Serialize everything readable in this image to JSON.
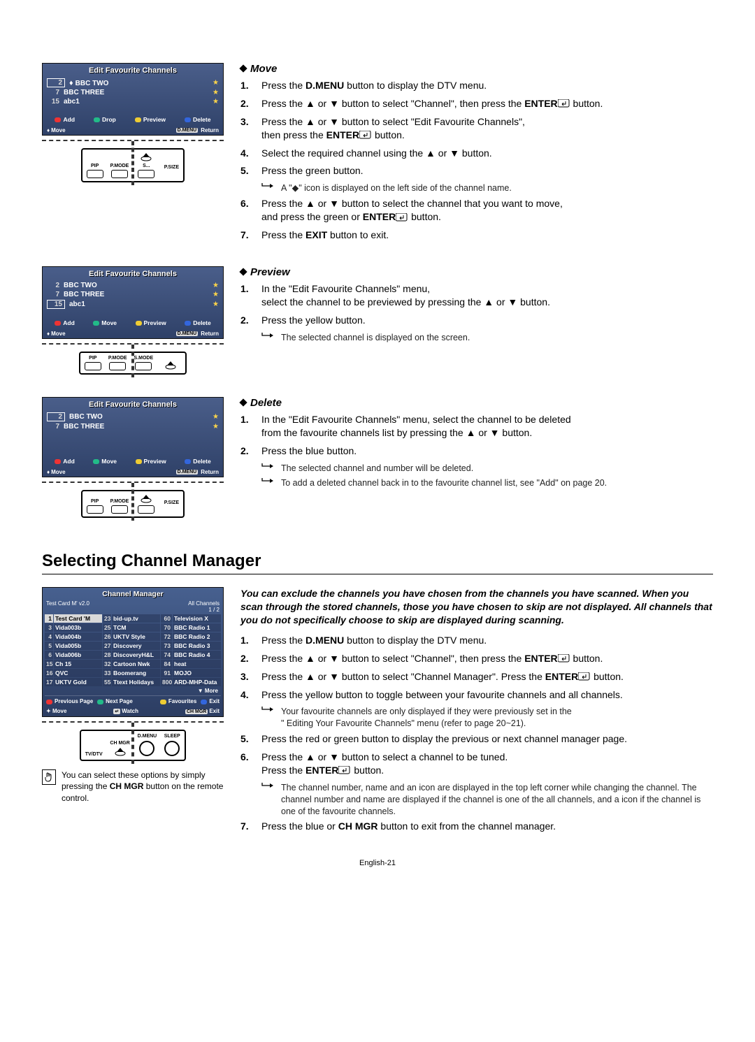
{
  "osdTitle": "Edit Favourite Channels",
  "channels": {
    "bbcTwo": {
      "num": "2",
      "name": "BBC TWO"
    },
    "bbcThree": {
      "num": "7",
      "name": "BBC THREE"
    },
    "abc1": {
      "num": "15",
      "name": "abc1"
    }
  },
  "legend": {
    "add": "Add",
    "drop": "Drop",
    "move": "Move",
    "preview": "Preview",
    "delete": "Delete"
  },
  "osdFooter": {
    "move": "Move",
    "dmenu": "D.MENU",
    "ret": "Return"
  },
  "remote": {
    "pip": "PIP",
    "pmode": "P.MODE",
    "smode": "S.MODE",
    "sx": "S...",
    "psize": "P.SIZE",
    "ttv": "TV/DTV",
    "chmgr": "CH MGR",
    "dmenu": "D.MENU",
    "sleep": "SLEEP"
  },
  "move": {
    "title": "Move",
    "steps": [
      "Press the <b>D.MENU</b> button to display the DTV menu.",
      "Press the ▲ or ▼ button to select \"Channel\", then press the <b>ENTER</b><svg class='enter-icon' width='18' height='12'><rect x='0' y='0' width='16' height='11' rx='2' fill='none' stroke='#000'/><path d='M11 3 v4 h-5 m0 0 l2 -2 m-2 2 l2 2' stroke='#000' fill='none'/></svg> button.",
      "Press the ▲ or ▼ button to select \"Edit Favourite Channels\",<br>then press the <b>ENTER</b><svg class='enter-icon' width='18' height='12'><rect x='0' y='0' width='16' height='11' rx='2' fill='none' stroke='#000'/><path d='M11 3 v4 h-5 m0 0 l2 -2 m-2 2 l2 2' stroke='#000' fill='none'/></svg> button.",
      "Select the required channel using the ▲ or ▼ button.",
      "Press the green button.",
      "Press the ▲ or ▼ button to select the channel that you want to move,<br>and press the green or <b>ENTER</b><svg class='enter-icon' width='18' height='12'><rect x='0' y='0' width='16' height='11' rx='2' fill='none' stroke='#000'/><path d='M11 3 v4 h-5 m0 0 l2 -2 m-2 2 l2 2' stroke='#000' fill='none'/></svg> button.",
      "Press the <b>EXIT</b> button to exit."
    ],
    "note5": "A \"<span class='inline-icon'>◆</span>\" icon is displayed on the left side of the channel name."
  },
  "preview": {
    "title": "Preview",
    "steps": [
      "In the \"Edit Favourite Channels\" menu,<br>select the channel to be previewed by pressing the ▲ or ▼ button.",
      "Press the yellow button."
    ],
    "note2": "The selected channel is displayed on the screen."
  },
  "delete": {
    "title": "Delete",
    "steps": [
      "In the \"Edit Favourite Channels\" menu, select the channel to be deleted<br>from the favourite channels list by pressing the ▲ or ▼ button.",
      "Press the blue button."
    ],
    "notes": [
      "The selected channel and number will be deleted.",
      "To add a deleted channel back in to the favourite channel list, see \"Add\" on page 20."
    ]
  },
  "selectCM": {
    "title": "Selecting Channel Manager",
    "intro": "You can exclude the channels you have chosen from the channels you have scanned. When you scan through the stored channels, those you have chosen to skip are not displayed. All channels that you do not specifically choose to skip are displayed during scanning.",
    "steps": [
      "Press the <b>D.MENU</b> button to display the DTV menu.",
      "Press the ▲ or ▼ button to select \"Channel\", then press the <b>ENTER</b><svg class='enter-icon' width='18' height='12'><rect x='0' y='0' width='16' height='11' rx='2' fill='none' stroke='#000'/><path d='M11 3 v4 h-5 m0 0 l2 -2 m-2 2 l2 2' stroke='#000' fill='none'/></svg> button.",
      "Press the ▲ or ▼ button to select \"Channel Manager\". Press the <b>ENTER</b><svg class='enter-icon' width='18' height='12'><rect x='0' y='0' width='16' height='11' rx='2' fill='none' stroke='#000'/><path d='M11 3 v4 h-5 m0 0 l2 -2 m-2 2 l2 2' stroke='#000' fill='none'/></svg> button.",
      "Press the yellow button to toggle between your favourite channels and all channels.",
      "Press the red or green button to display the previous or next channel manager page.",
      "Press the ▲ or ▼ button to select a channel to be tuned.<br>Press the <b>ENTER</b><svg class='enter-icon' width='18' height='12'><rect x='0' y='0' width='16' height='11' rx='2' fill='none' stroke='#000'/><path d='M11 3 v4 h-5 m0 0 l2 -2 m-2 2 l2 2' stroke='#000' fill='none'/></svg> button.",
      "Press the blue or <b>CH MGR</b> button to exit from the channel manager."
    ],
    "notes4": [
      "Your favourite channels are only displayed if they were previously set in the",
      "\" Editing Your Favourite Channels\" menu (refer to page 20~21)."
    ],
    "note6": "The channel number, name and an icon are displayed in the top left corner while changing the channel. The channel number and name are displayed if the channel is one of the all channels, and a  icon if the channel is one of the favourite channels."
  },
  "cm": {
    "title": "Channel Manager",
    "headL": "Test Card M' v2.0",
    "headR1": "All Channels",
    "headR2": "1 / 2",
    "rows": [
      [
        "1",
        "Test Card 'M",
        "23",
        "bid-up.tv",
        "60",
        "Television X"
      ],
      [
        "3",
        "Vida003b",
        "25",
        "TCM",
        "70",
        "BBC Radio 1"
      ],
      [
        "4",
        "Vida004b",
        "26",
        "UKTV Style",
        "72",
        "BBC Radio 2"
      ],
      [
        "5",
        "Vida005b",
        "27",
        "Discovery",
        "73",
        "BBC Radio 3"
      ],
      [
        "6",
        "Vida006b",
        "28",
        "DiscoveryH&L",
        "74",
        "BBC Radio 4"
      ],
      [
        "15",
        "Ch 15",
        "32",
        "Cartoon Nwk",
        "84",
        "heat"
      ],
      [
        "16",
        "QVC",
        "33",
        "Boomerang",
        "91",
        "MOJO"
      ],
      [
        "17",
        "UKTV Gold",
        "55",
        "Ttext Holidays",
        "800",
        "ARD-MHP-Data"
      ]
    ],
    "more": "▼ More",
    "legend": {
      "prev": "Previous Page",
      "next": "Next Page",
      "fav": "Favourites",
      "exit": "Exit"
    },
    "foot": {
      "move": "Move",
      "watch": "Watch",
      "exit": "Exit",
      "chip": "CH MGR",
      "enterChip": "↵"
    }
  },
  "tip": "You can select these options  by simply pressing the  <b>CH MGR</b> button on the remote control.",
  "pageNum": "English-21"
}
